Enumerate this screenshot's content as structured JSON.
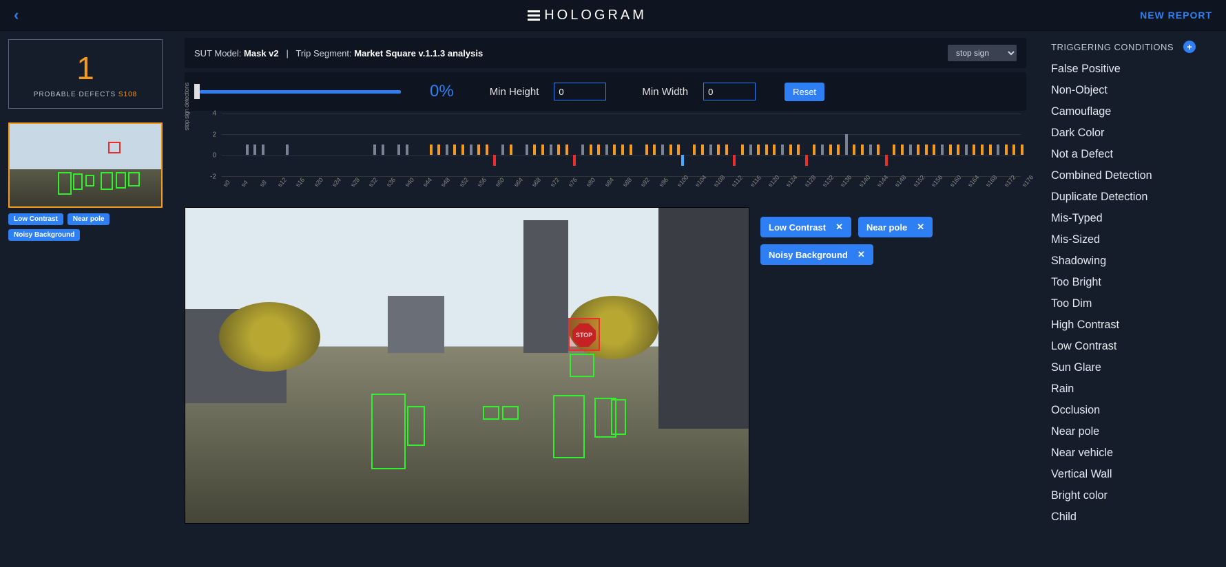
{
  "header": {
    "brand": "HOLOGRAM",
    "new_report": "NEW REPORT"
  },
  "defect_card": {
    "count": "1",
    "label": "PROBABLE DEFECTS",
    "sid": "S108"
  },
  "thumb_tags": [
    "Low Contrast",
    "Near pole",
    "Noisy Background"
  ],
  "meta": {
    "sut_label": "SUT Model:",
    "sut_value": "Mask v2",
    "sep": "|",
    "seg_label": "Trip Segment:",
    "seg_value": "Market Square v.1.1.3 analysis",
    "class_select": "stop sign"
  },
  "controls": {
    "pct": "0%",
    "min_height_label": "Min Height",
    "min_height_value": "0",
    "min_width_label": "Min Width",
    "min_width_value": "0",
    "reset": "Reset"
  },
  "chart_data": {
    "type": "bar",
    "ylabel": "stop sign detections",
    "ylim": [
      -2,
      4
    ],
    "y_ticks": [
      -2,
      0,
      2,
      4
    ],
    "x_ticks": [
      "s0",
      "s4",
      "s8",
      "s12",
      "s16",
      "s20",
      "s24",
      "s28",
      "s32",
      "s36",
      "s40",
      "s44",
      "s48",
      "s52",
      "s56",
      "s60",
      "s64",
      "s68",
      "s72",
      "s76",
      "s80",
      "s84",
      "s88",
      "s92",
      "s96",
      "s100",
      "s104",
      "s108",
      "s112",
      "s116",
      "s120",
      "s124",
      "s128",
      "s132",
      "s136",
      "s140",
      "s144",
      "s148",
      "s152",
      "s156",
      "s160",
      "s164",
      "s168",
      "s172",
      "s176"
    ],
    "bars": [
      {
        "x": 3,
        "v": 1,
        "c": "g"
      },
      {
        "x": 4,
        "v": 1,
        "c": "g"
      },
      {
        "x": 5,
        "v": 1,
        "c": "g"
      },
      {
        "x": 8,
        "v": 1,
        "c": "g"
      },
      {
        "x": 19,
        "v": 1,
        "c": "g"
      },
      {
        "x": 20,
        "v": 1,
        "c": "g"
      },
      {
        "x": 22,
        "v": 1,
        "c": "g"
      },
      {
        "x": 23,
        "v": 1,
        "c": "g"
      },
      {
        "x": 26,
        "v": 1,
        "c": "o"
      },
      {
        "x": 27,
        "v": 1,
        "c": "o"
      },
      {
        "x": 28,
        "v": 1,
        "c": "g"
      },
      {
        "x": 29,
        "v": 1,
        "c": "o"
      },
      {
        "x": 30,
        "v": 1,
        "c": "o"
      },
      {
        "x": 31,
        "v": 1,
        "c": "g"
      },
      {
        "x": 32,
        "v": 1,
        "c": "o"
      },
      {
        "x": 33,
        "v": 1,
        "c": "o"
      },
      {
        "x": 34,
        "v": -1,
        "c": "r"
      },
      {
        "x": 35,
        "v": 1,
        "c": "g"
      },
      {
        "x": 36,
        "v": 1,
        "c": "o"
      },
      {
        "x": 38,
        "v": 1,
        "c": "g"
      },
      {
        "x": 39,
        "v": 1,
        "c": "o"
      },
      {
        "x": 40,
        "v": 1,
        "c": "o"
      },
      {
        "x": 41,
        "v": 1,
        "c": "g"
      },
      {
        "x": 42,
        "v": 1,
        "c": "o"
      },
      {
        "x": 43,
        "v": 1,
        "c": "o"
      },
      {
        "x": 44,
        "v": -1,
        "c": "r"
      },
      {
        "x": 45,
        "v": 1,
        "c": "g"
      },
      {
        "x": 46,
        "v": 1,
        "c": "o"
      },
      {
        "x": 47,
        "v": 1,
        "c": "o"
      },
      {
        "x": 48,
        "v": 1,
        "c": "g"
      },
      {
        "x": 49,
        "v": 1,
        "c": "o"
      },
      {
        "x": 50,
        "v": 1,
        "c": "o"
      },
      {
        "x": 51,
        "v": 1,
        "c": "o"
      },
      {
        "x": 53,
        "v": 1,
        "c": "o"
      },
      {
        "x": 54,
        "v": 1,
        "c": "o"
      },
      {
        "x": 55,
        "v": 1,
        "c": "g"
      },
      {
        "x": 56,
        "v": 1,
        "c": "o"
      },
      {
        "x": 57,
        "v": 1,
        "c": "o"
      },
      {
        "x": 57.5,
        "v": -1,
        "c": "b"
      },
      {
        "x": 59,
        "v": 1,
        "c": "o"
      },
      {
        "x": 60,
        "v": 1,
        "c": "o"
      },
      {
        "x": 61,
        "v": 1,
        "c": "g"
      },
      {
        "x": 62,
        "v": 1,
        "c": "o"
      },
      {
        "x": 63,
        "v": 1,
        "c": "o"
      },
      {
        "x": 64,
        "v": -1,
        "c": "r"
      },
      {
        "x": 65,
        "v": 1,
        "c": "o"
      },
      {
        "x": 66,
        "v": 1,
        "c": "g"
      },
      {
        "x": 67,
        "v": 1,
        "c": "o"
      },
      {
        "x": 68,
        "v": 1,
        "c": "o"
      },
      {
        "x": 69,
        "v": 1,
        "c": "o"
      },
      {
        "x": 70,
        "v": 1,
        "c": "g"
      },
      {
        "x": 71,
        "v": 1,
        "c": "o"
      },
      {
        "x": 72,
        "v": 1,
        "c": "o"
      },
      {
        "x": 73,
        "v": -1,
        "c": "r"
      },
      {
        "x": 74,
        "v": 1,
        "c": "o"
      },
      {
        "x": 75,
        "v": 1,
        "c": "g"
      },
      {
        "x": 76,
        "v": 1,
        "c": "o"
      },
      {
        "x": 77,
        "v": 1,
        "c": "o"
      },
      {
        "x": 78,
        "v": 2,
        "c": "g"
      },
      {
        "x": 79,
        "v": 1,
        "c": "o"
      },
      {
        "x": 80,
        "v": 1,
        "c": "o"
      },
      {
        "x": 81,
        "v": 1,
        "c": "g"
      },
      {
        "x": 82,
        "v": 1,
        "c": "o"
      },
      {
        "x": 83,
        "v": -1,
        "c": "r"
      },
      {
        "x": 84,
        "v": 1,
        "c": "o"
      },
      {
        "x": 85,
        "v": 1,
        "c": "o"
      },
      {
        "x": 86,
        "v": 1,
        "c": "g"
      },
      {
        "x": 87,
        "v": 1,
        "c": "o"
      },
      {
        "x": 88,
        "v": 1,
        "c": "o"
      },
      {
        "x": 89,
        "v": 1,
        "c": "o"
      },
      {
        "x": 90,
        "v": 1,
        "c": "g"
      },
      {
        "x": 91,
        "v": 1,
        "c": "o"
      },
      {
        "x": 92,
        "v": 1,
        "c": "o"
      },
      {
        "x": 93,
        "v": 1,
        "c": "g"
      },
      {
        "x": 94,
        "v": 1,
        "c": "o"
      },
      {
        "x": 95,
        "v": 1,
        "c": "o"
      },
      {
        "x": 96,
        "v": 1,
        "c": "o"
      },
      {
        "x": 97,
        "v": 1,
        "c": "g"
      },
      {
        "x": 98,
        "v": 1,
        "c": "o"
      },
      {
        "x": 99,
        "v": 1,
        "c": "o"
      },
      {
        "x": 100,
        "v": 1,
        "c": "o"
      }
    ]
  },
  "applied_tags": [
    "Low Contrast",
    "Near pole",
    "Noisy Background"
  ],
  "triggering": {
    "title": "TRIGGERING CONDITIONS",
    "items": [
      "False Positive",
      "Non-Object",
      "Camouflage",
      "Dark Color",
      "Not a Defect",
      "Combined Detection",
      "Duplicate Detection",
      "Mis-Typed",
      "Mis-Sized",
      "Shadowing",
      "Too Bright",
      "Too Dim",
      "High Contrast",
      "Low Contrast",
      "Sun Glare",
      "Rain",
      "Occlusion",
      "Near pole",
      "Near vehicle",
      "Vertical Wall",
      "Bright color",
      "Child"
    ]
  },
  "stop_text": "STOP"
}
